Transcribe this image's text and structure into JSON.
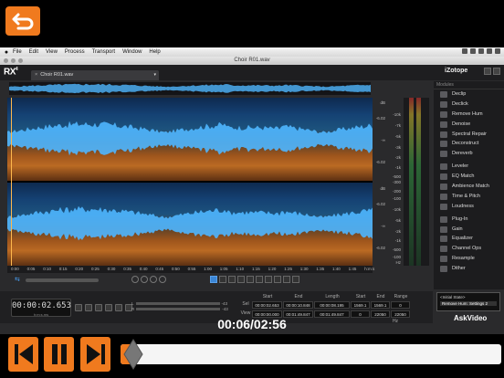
{
  "colors": {
    "accent": "#f07a1e",
    "selection_blue": "#3b86d6",
    "waveform": "#4fb6ff"
  },
  "back_icon": "back-arrow-icon",
  "menubar": {
    "app_name": "iZotope RX 4",
    "items": [
      "File",
      "Edit",
      "View",
      "Process",
      "Transport",
      "Window",
      "Help"
    ]
  },
  "window_title": "Choir R01.wav",
  "app": {
    "logo": "RX",
    "logo_sup": "4",
    "file_tab": "Choir R01.wav",
    "brand": "iZotope"
  },
  "scale": {
    "db": [
      "dB",
      "-6.02",
      "-∞",
      "-6.02",
      "dB",
      "-6.02",
      "-∞",
      "-6.02"
    ],
    "hz": [
      "-10k",
      "-7k",
      "-5k",
      "-3k",
      "-2k",
      "-1k",
      "-500",
      "-300",
      "-200",
      "-100",
      "-10k",
      "-5k",
      "-2k",
      "-1k",
      "-500",
      "-100",
      "Hz"
    ]
  },
  "ruler": [
    "0:00",
    "0:05",
    "0:10",
    "0:15",
    "0:20",
    "0:25",
    "0:30",
    "0:35",
    "0:40",
    "0:45",
    "0:50",
    "0:55",
    "1:00",
    "1:05",
    "1:10",
    "1:15",
    "1:20",
    "1:25",
    "1:30",
    "1:35",
    "1:40",
    "1:45",
    "h:m:s"
  ],
  "transport": {
    "time": "00:00:02.653",
    "time_sub": "h:m:s.ms",
    "meter_labels": {
      "l": "L",
      "r": "R",
      "l_val": "-43",
      "r_val": "-43"
    }
  },
  "info": {
    "headers": [
      "Start",
      "End",
      "Length",
      "Start",
      "End",
      "Range"
    ],
    "row_label": "Sel",
    "sel": [
      "00:00:02.653",
      "00:00:10.848",
      "00:00:08.195",
      "1569.1",
      "1569.1",
      "0"
    ],
    "view_label": "View",
    "view": [
      "00:00:00.000",
      "00:01:49.847",
      "00:01:49.847",
      "0",
      "22050",
      "22050"
    ],
    "unit": "Hz"
  },
  "modules": {
    "header": "Modules",
    "items": [
      {
        "label": "Declip",
        "icon": "declip-icon"
      },
      {
        "label": "Declick",
        "icon": "declick-icon"
      },
      {
        "label": "Remove Hum",
        "icon": "remove-hum-icon"
      },
      {
        "label": "Denoise",
        "icon": "denoise-icon"
      },
      {
        "label": "Spectral Repair",
        "icon": "spectral-repair-icon"
      },
      {
        "label": "Deconstruct",
        "icon": "deconstruct-icon"
      },
      {
        "label": "Dereverb",
        "icon": "dereverb-icon"
      },
      {
        "label": "Leveler",
        "icon": "leveler-icon"
      },
      {
        "label": "EQ Match",
        "icon": "eq-match-icon"
      },
      {
        "label": "Ambience Match",
        "icon": "ambience-match-icon"
      },
      {
        "label": "Time & Pitch",
        "icon": "time-pitch-icon"
      },
      {
        "label": "Loudness",
        "icon": "loudness-icon"
      },
      {
        "label": "Plug-In",
        "icon": "plug-in-icon"
      },
      {
        "label": "Gain",
        "icon": "gain-icon"
      },
      {
        "label": "Equalizer",
        "icon": "equalizer-icon"
      },
      {
        "label": "Channel Ops",
        "icon": "channel-ops-icon"
      },
      {
        "label": "Resample",
        "icon": "resample-icon"
      },
      {
        "label": "Dither",
        "icon": "dither-icon"
      }
    ]
  },
  "history": {
    "initial": "<Initial State>",
    "current": "Remove Hum: Settings 2"
  },
  "watermark": "AskVideo",
  "player": {
    "time_label": "00:06/02:56",
    "progress_fraction": 0.034,
    "buttons": [
      "skip-back-icon",
      "pause-icon",
      "skip-forward-icon"
    ]
  }
}
